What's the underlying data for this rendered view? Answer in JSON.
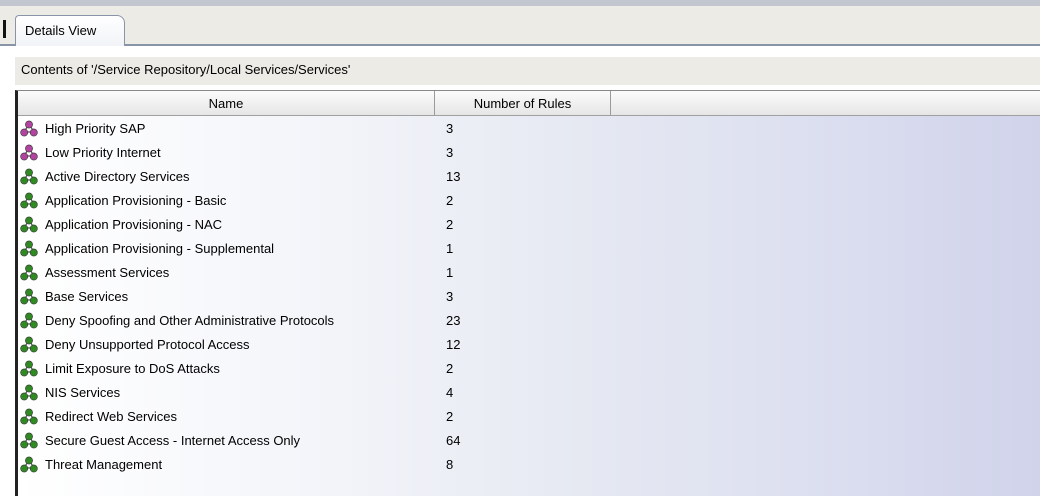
{
  "tab": {
    "label": "Details View"
  },
  "path": {
    "text": "Contents of '/Service Repository/Local Services/Services'"
  },
  "table": {
    "columns": [
      "Name",
      "Number of Rules"
    ],
    "rows": [
      {
        "name": "High Priority SAP",
        "rules": "3",
        "icon": "service-icon",
        "color": "#b0449f"
      },
      {
        "name": "Low Priority Internet",
        "rules": "3",
        "icon": "service-icon",
        "color": "#b0449f"
      },
      {
        "name": "Active Directory Services",
        "rules": "13",
        "icon": "service-icon",
        "color": "#2f8a22"
      },
      {
        "name": "Application Provisioning - Basic",
        "rules": "2",
        "icon": "service-icon",
        "color": "#2f8a22"
      },
      {
        "name": "Application Provisioning - NAC",
        "rules": "2",
        "icon": "service-icon",
        "color": "#2f8a22"
      },
      {
        "name": "Application Provisioning - Supplemental",
        "rules": "1",
        "icon": "service-icon",
        "color": "#2f8a22"
      },
      {
        "name": "Assessment Services",
        "rules": "1",
        "icon": "service-icon",
        "color": "#2f8a22"
      },
      {
        "name": "Base Services",
        "rules": "3",
        "icon": "service-icon",
        "color": "#2f8a22"
      },
      {
        "name": "Deny Spoofing and Other Administrative Protocols",
        "rules": "23",
        "icon": "service-icon",
        "color": "#2f8a22"
      },
      {
        "name": "Deny Unsupported Protocol Access",
        "rules": "12",
        "icon": "service-icon",
        "color": "#2f8a22"
      },
      {
        "name": "Limit Exposure to DoS Attacks",
        "rules": "2",
        "icon": "service-icon",
        "color": "#2f8a22"
      },
      {
        "name": "NIS Services",
        "rules": "4",
        "icon": "service-icon",
        "color": "#2f8a22"
      },
      {
        "name": "Redirect Web Services",
        "rules": "2",
        "icon": "service-icon",
        "color": "#2f8a22"
      },
      {
        "name": "Secure Guest Access - Internet Access Only",
        "rules": "64",
        "icon": "service-icon",
        "color": "#2f8a22"
      },
      {
        "name": "Threat Management",
        "rules": "8",
        "icon": "service-icon",
        "color": "#2f8a22"
      }
    ]
  }
}
